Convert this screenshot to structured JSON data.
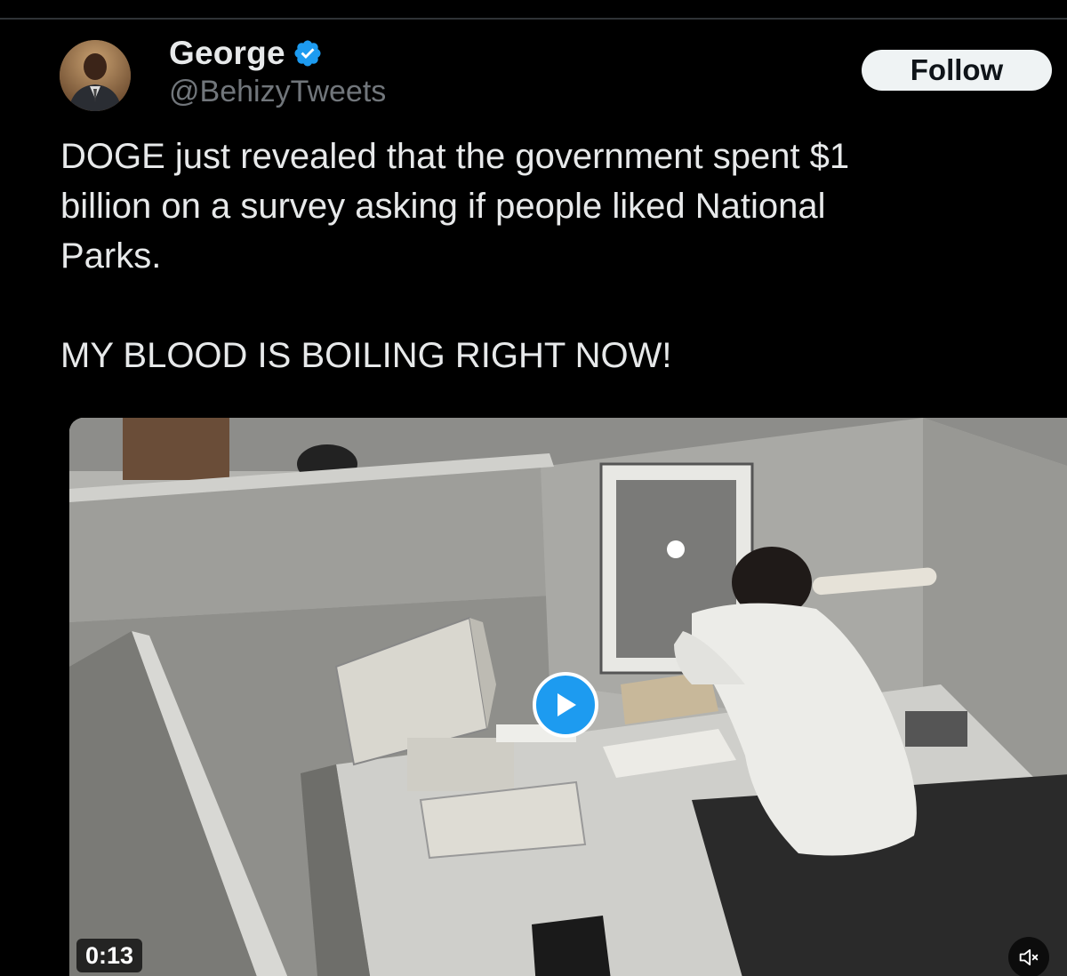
{
  "tweet": {
    "author": {
      "display_name": "George",
      "handle": "@BehizyTweets",
      "verified": true,
      "avatar_icon": "profile-photo"
    },
    "follow_label": "Follow",
    "text_lines": [
      "DOGE just revealed that the government spent $1",
      "billion on a survey asking if people liked National",
      "Parks."
    ],
    "text_line_2": "MY BLOOD IS BOILING RIGHT NOW!",
    "media": {
      "type": "video",
      "duration": "0:13",
      "play_icon": "play-icon",
      "mute_icon": "muted-speaker-icon"
    }
  },
  "colors": {
    "background": "#000000",
    "primary_text": "#e7e9ea",
    "secondary_text": "#71767b",
    "accent": "#1d9bf0",
    "follow_bg": "#eff3f4"
  }
}
